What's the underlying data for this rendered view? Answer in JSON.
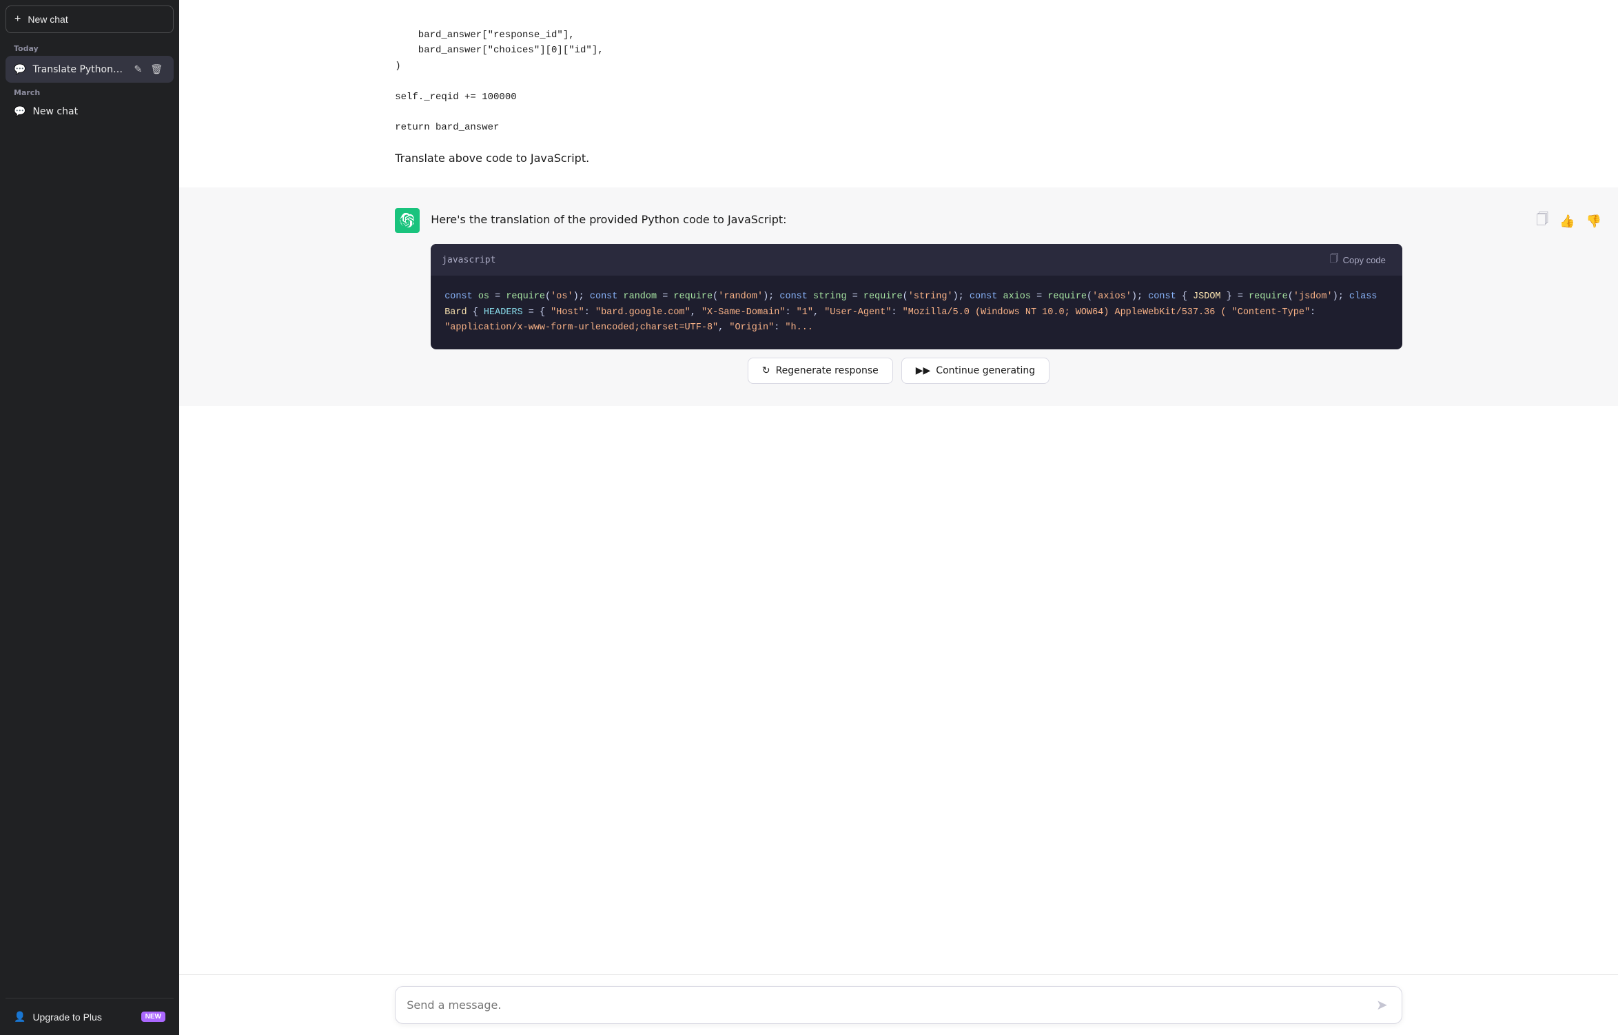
{
  "sidebar": {
    "new_chat_label": "New chat",
    "today_label": "Today",
    "march_label": "March",
    "chat_items": [
      {
        "id": "translate-python",
        "label": "Translate Python to Jav",
        "active": true,
        "section": "today"
      },
      {
        "id": "new-chat-march",
        "label": "New chat",
        "active": false,
        "section": "march"
      }
    ],
    "upgrade_label": "Upgrade to Plus",
    "new_badge": "NEW"
  },
  "main": {
    "user_code": "    bard_answer[\"response_id\"],\n    bard_answer[\"choices\"][0][\"id\"],\n)\n\nself._reqid += 100000\n\nreturn bard_answer",
    "translate_text": "Translate above code to JavaScript.",
    "assistant_intro": "Here's the translation of the provided Python code to JavaScript:",
    "code_lang": "javascript",
    "copy_code_label": "Copy code",
    "code_lines": [
      {
        "type": "code",
        "text": "const os = require('os');"
      },
      {
        "type": "code",
        "text": "const random = require('random');"
      },
      {
        "type": "code",
        "text": "const string = require('string');"
      },
      {
        "type": "code",
        "text": "const axios = require('axios');"
      },
      {
        "type": "code",
        "text": "const { JSDOM } = require('jsdom');"
      },
      {
        "type": "blank"
      },
      {
        "type": "code",
        "text": "class Bard {"
      },
      {
        "type": "code",
        "text": "  HEADERS = {"
      },
      {
        "type": "code",
        "text": "    \"Host\": \"bard.google.com\","
      },
      {
        "type": "code",
        "text": "    \"X-Same-Domain\": \"1\","
      },
      {
        "type": "code",
        "text": "    \"User-Agent\": \"Mozilla/5.0 (Windows NT 10.0; WOW64) AppleWebKit/537.36 ("
      },
      {
        "type": "code",
        "text": "    \"Content-Type\": \"application/x-www-form-urlencoded;charset=UTF-8\","
      },
      {
        "type": "code",
        "text": "    \"Origin\": \"h..."
      }
    ],
    "regenerate_label": "Regenerate response",
    "continue_label": "Continue generating",
    "input_placeholder": "Send a message."
  }
}
